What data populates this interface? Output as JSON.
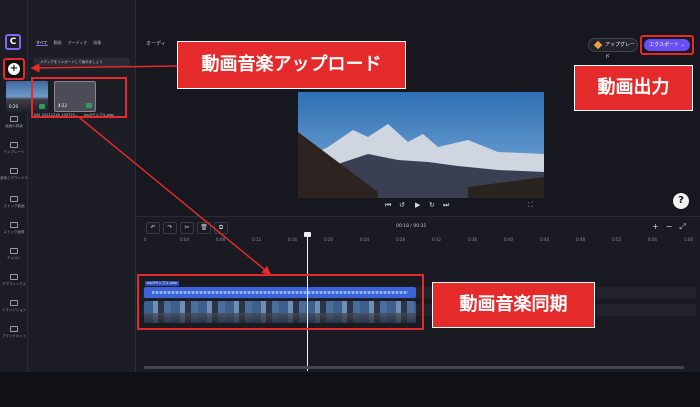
{
  "rail": {
    "logo": "C",
    "items": [
      {
        "label": "メディア",
        "icon": "folder-icon"
      },
      {
        "label": "画面の録画",
        "icon": "record-icon"
      },
      {
        "label": "テンプレート",
        "icon": "template-icon"
      },
      {
        "label": "音楽とサウンドエフェクト",
        "icon": "music-icon"
      },
      {
        "label": "ストック動画",
        "icon": "stock-video-icon"
      },
      {
        "label": "ストック画像",
        "icon": "stock-image-icon"
      },
      {
        "label": "テキスト",
        "icon": "text-icon"
      },
      {
        "label": "グラフィックス",
        "icon": "graphics-icon"
      },
      {
        "label": "トランジション",
        "icon": "transition-icon"
      },
      {
        "label": "ブランドキット",
        "icon": "brand-kit-icon"
      }
    ]
  },
  "media": {
    "tabs": [
      "すべて",
      "動画",
      "オーディオ",
      "画像"
    ],
    "dropdown": "メディアをインポートして始めましょう",
    "items": [
      {
        "name": "VID_20211216_105725...",
        "duration": "0:20"
      },
      {
        "name": "mp3サンプル.wav",
        "duration": "4:22"
      }
    ]
  },
  "topbar": {
    "aspect": "オーディ",
    "upgrade": "アップグレード",
    "export": "エクスポート"
  },
  "timeline": {
    "time": "00:18 / 00:31",
    "ticks": [
      "0",
      "0:02",
      "0:04",
      "0:06",
      "0:08",
      "0:10",
      "0:12",
      "0:14",
      "0:16",
      "0:18",
      "0:20",
      "0:22",
      "0:24",
      "0:26",
      "0:28",
      "0:30",
      "0:32",
      "0:34",
      "0:36",
      "0:38",
      "0:40",
      "0:42",
      "0:44",
      "0:46",
      "0:48",
      "0:50",
      "0:52",
      "0:54",
      "0:56",
      "0:58",
      "1:00"
    ],
    "audio_clip": "mp3サンプル.wav"
  },
  "annotations": {
    "upload": "動画音楽アップロード",
    "export": "動画出力",
    "sync": "動画音楽同期"
  },
  "colors": {
    "accent": "#6a4ef5",
    "annotation": "#e42a2a",
    "audio": "#3d63d8"
  }
}
